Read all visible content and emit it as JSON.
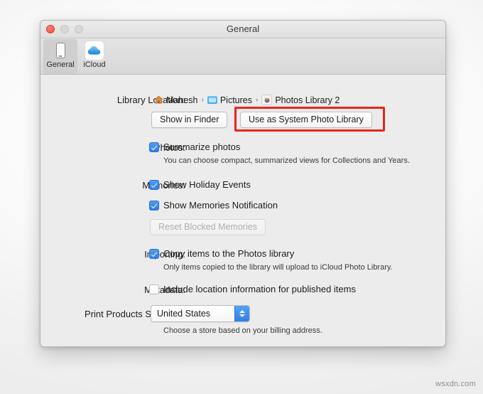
{
  "window": {
    "title": "General",
    "traffic_lights": [
      "close",
      "minimize",
      "zoom"
    ]
  },
  "toolbar": {
    "items": [
      {
        "label": "General",
        "icon": "device-icon",
        "selected": true
      },
      {
        "label": "iCloud",
        "icon": "icloud-icon",
        "selected": false
      }
    ]
  },
  "settings": {
    "library_location": {
      "label": "Library Location:",
      "breadcrumb": [
        {
          "icon": "home-icon",
          "text": "Mahesh"
        },
        {
          "icon": "folder-icon",
          "text": "Pictures"
        },
        {
          "icon": "photos-library-icon",
          "text": "Photos Library 2"
        }
      ],
      "separator": "›",
      "show_in_finder_button": "Show in Finder",
      "use_as_system_button": "Use as System Photo Library"
    },
    "photos": {
      "label": "Photos:",
      "summarize_checkbox": {
        "text": "Summarize photos",
        "checked": true
      },
      "hint": "You can choose compact, summarized views for Collections and Years."
    },
    "memories": {
      "label": "Memories:",
      "holiday_checkbox": {
        "text": "Show Holiday Events",
        "checked": true
      },
      "notification_checkbox": {
        "text": "Show Memories Notification",
        "checked": true
      },
      "reset_button": {
        "text": "Reset Blocked Memories",
        "disabled": true
      }
    },
    "importing": {
      "label": "Importing:",
      "copy_checkbox": {
        "text": "Copy items to the Photos library",
        "checked": true
      },
      "hint": "Only items copied to the library will upload to iCloud Photo Library."
    },
    "metadata": {
      "label": "Metadata:",
      "location_checkbox": {
        "text": "Include location information for published items",
        "checked": false
      }
    },
    "print_store": {
      "label": "Print Products Store:",
      "selected": "United States",
      "hint": "Choose a store based on your billing address."
    }
  },
  "annotation": {
    "highlight_color": "#e8251a",
    "highlight_target": "Use as System Photo Library"
  },
  "watermark": "wsxdn.com"
}
